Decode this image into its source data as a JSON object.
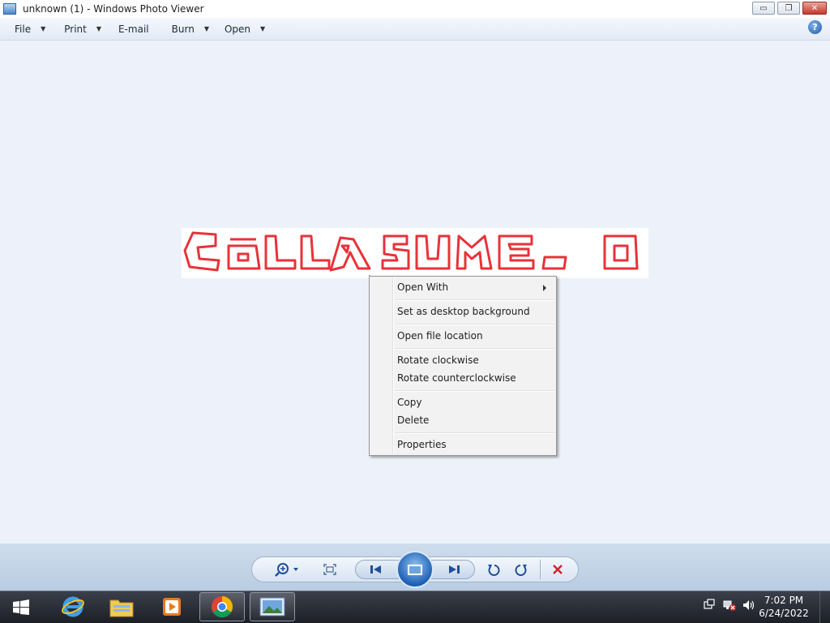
{
  "window": {
    "title": "unknown (1) - Windows Photo Viewer",
    "controls": {
      "minimize": "▭",
      "maximize": "❐",
      "close": "✕"
    }
  },
  "menubar": {
    "items": [
      {
        "label": "File",
        "has_dropdown": true
      },
      {
        "label": "Print",
        "has_dropdown": true
      },
      {
        "label": "E-mail",
        "has_dropdown": false
      },
      {
        "label": "Burn",
        "has_dropdown": true
      },
      {
        "label": "Open",
        "has_dropdown": true
      }
    ],
    "help_icon": "?"
  },
  "photo": {
    "text": "CŌLLABSUME.O",
    "stroke_color": "#e8323a"
  },
  "context_menu": {
    "items": [
      {
        "label": "Open With",
        "submenu": true
      },
      {
        "label": "Set as desktop background"
      },
      {
        "label": "Open file location"
      },
      {
        "label": "Rotate clockwise"
      },
      {
        "label": "Rotate counterclockwise"
      },
      {
        "label": "Copy"
      },
      {
        "label": "Delete"
      },
      {
        "label": "Properties"
      }
    ]
  },
  "toolbar": {
    "buttons": [
      "zoom-icon",
      "actual-size-icon",
      "previous-icon",
      "slideshow-icon",
      "next-icon",
      "rotate-counterclockwise-icon",
      "rotate-clockwise-icon",
      "delete-icon"
    ]
  },
  "taskbar": {
    "pinned": [
      "internet-explorer-icon",
      "file-explorer-icon",
      "media-player-icon",
      "chrome-icon",
      "photo-viewer-icon"
    ],
    "clock": {
      "time": "7:02 PM",
      "date": "6/24/2022"
    }
  },
  "colors": {
    "accent": "#1f5aa8",
    "delete": "#d6202a",
    "viewer_bg": "#edf2fa"
  }
}
